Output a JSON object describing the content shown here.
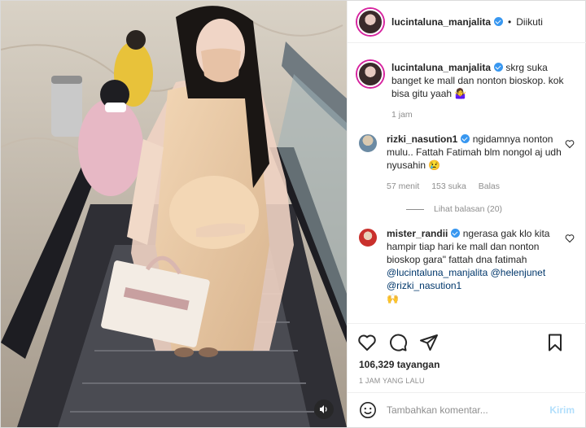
{
  "header": {
    "username": "lucintaluna_manjalita",
    "separator": "•",
    "follow_label": "Diikuti"
  },
  "caption": {
    "username": "lucintaluna_manjalita",
    "text": "skrg suka banget ke mall dan nonton bioskop. kok bisa gitu yaah 🤷‍♀️",
    "time": "1 jam"
  },
  "comments": [
    {
      "username": "rizki_nasution1",
      "text": "ngidamnya nonton mulu.. Fattah Fatimah blm nongol aj udh nyusahin 😢",
      "time": "57 menit",
      "likes": "153 suka",
      "reply_label": "Balas",
      "view_replies": "Lihat balasan (20)"
    },
    {
      "username": "mister_randii",
      "text": "ngerasa gak klo kita hampir tiap hari ke mall dan nonton bioskop gara\" fattah dna fatimah",
      "mentions": [
        "@lucintaluna_manjalita",
        "@helenjunet",
        "@rizki_nasution1"
      ],
      "emoji": "🙌"
    }
  ],
  "stats": {
    "views": "106,329 tayangan",
    "time": "1 JAM YANG LALU"
  },
  "add_comment": {
    "placeholder": "Tambahkan komentar...",
    "post_label": "Kirim"
  },
  "icons": {
    "heart": "heart-icon",
    "comment": "comment-icon",
    "share": "share-icon",
    "save": "bookmark-icon",
    "emoji": "emoji-icon",
    "sound": "speaker-icon"
  },
  "colors": {
    "verified": "#3897f0",
    "link": "#00376b",
    "post_disabled": "#b2dffc"
  }
}
